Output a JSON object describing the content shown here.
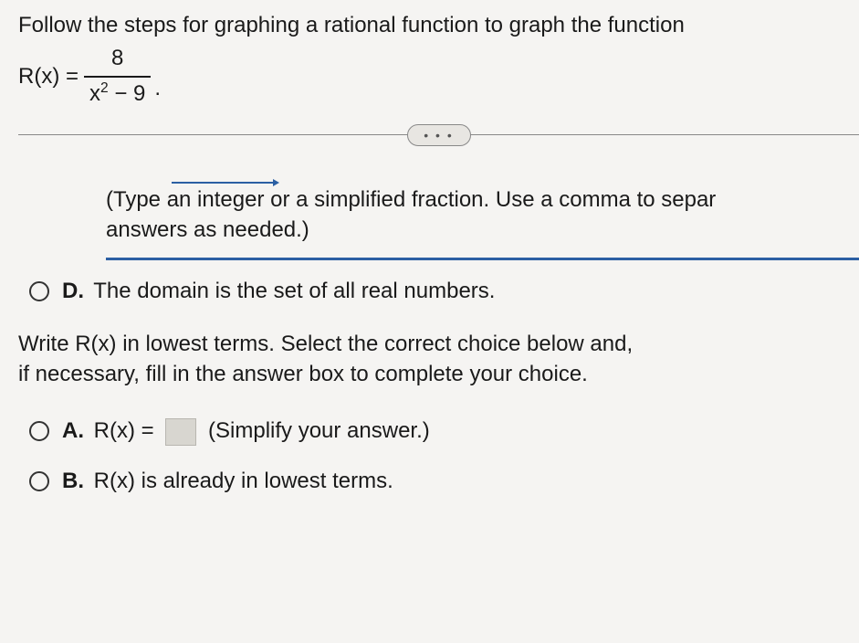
{
  "intro": "Follow the steps for graphing a rational function to graph the function",
  "eqn": {
    "label": "R(x) =",
    "numerator": "8",
    "den_base": "x",
    "den_exp": "2",
    "den_rest": " − 9",
    "period": "."
  },
  "divider_dots": "• • •",
  "hint_line1": "(Type an integer or a simplified fraction. Use a comma to separ",
  "hint_line2": "answers as needed.)",
  "option_d": {
    "letter": "D.",
    "text": "The domain is the set of all real numbers."
  },
  "prompt_line1": "Write R(x) in lowest terms. Select the correct choice below and,",
  "prompt_line2": "if necessary, fill in the answer box to complete your choice.",
  "option_a": {
    "letter": "A.",
    "prefix": "R(x) =",
    "suffix": "(Simplify your answer.)"
  },
  "option_b": {
    "letter": "B.",
    "text": "R(x) is already in lowest terms."
  }
}
